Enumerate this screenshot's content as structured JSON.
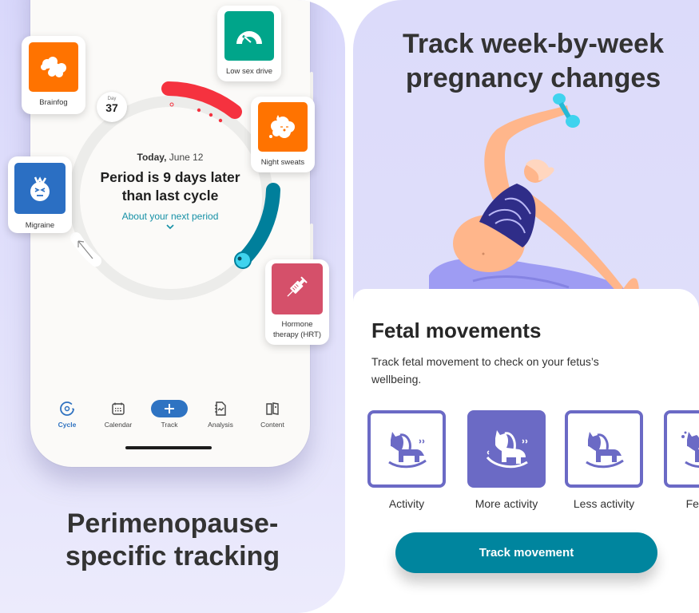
{
  "left": {
    "headline_line1": "Perimenopause-",
    "headline_line2": "specific tracking",
    "cycle": {
      "day_label": "Day",
      "day_number": "37",
      "today_prefix": "Today,",
      "today_date": "June 12",
      "status_line1": "Period is 9 days later",
      "status_line2": "than last cycle",
      "next_period_link": "About your next period"
    },
    "symptoms": [
      {
        "label": "Brainfog",
        "color": "#ff7300",
        "icon": "cloud-icon"
      },
      {
        "label": "Low sex drive",
        "color": "#00a58a",
        "icon": "gauge-icon"
      },
      {
        "label": "Night sweats",
        "color": "#ff7300",
        "icon": "sweat-cloud-icon"
      },
      {
        "label": "Migraine",
        "color": "#2b6fc3",
        "icon": "migraine-face-icon"
      },
      {
        "label_line1": "Hormone",
        "label_line2": "therapy (HRT)",
        "color": "#d5506a",
        "icon": "syringe-icon"
      }
    ],
    "tabs": [
      {
        "label": "Cycle",
        "active": true
      },
      {
        "label": "Calendar",
        "active": false
      },
      {
        "label": "Track",
        "active": false
      },
      {
        "label": "Analysis",
        "active": false
      },
      {
        "label": "Content",
        "active": false
      }
    ],
    "colors": {
      "period": "#f5323f",
      "fertile": "#007f9b",
      "accent": "#2e73c2"
    }
  },
  "right": {
    "headline_line1": "Track week-by-week",
    "headline_line2": "pregnancy changes",
    "card_title": "Fetal movements",
    "card_description": "Track fetal movement to check on your fetus’s wellbeing.",
    "options": [
      {
        "label": "Activity",
        "selected": false
      },
      {
        "label": "More activity",
        "selected": true
      },
      {
        "label": "Less activity",
        "selected": false
      },
      {
        "label": "Fetal h",
        "selected": false
      }
    ],
    "track_button": "Track movement",
    "colors": {
      "option": "#6b6ac5",
      "button": "#00859e"
    }
  }
}
